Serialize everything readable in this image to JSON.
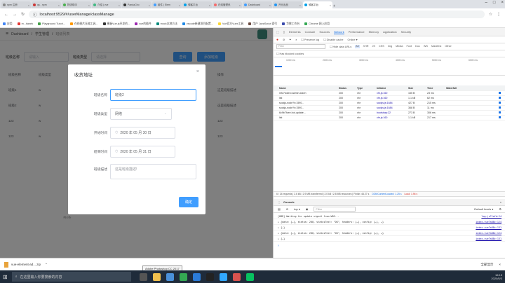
{
  "tabs": [
    {
      "label": "npm 注册",
      "color": "#888"
    },
    {
      "label": "qs - npm",
      "color": "#cb3837"
    },
    {
      "label": "物流助手",
      "color": "#4caf50"
    },
    {
      "label": "介绍 | vue",
      "color": "#42b983"
    },
    {
      "label": "PandaCho",
      "color": "#333"
    },
    {
      "label": "组件 | Elem",
      "color": "#409eff"
    },
    {
      "label": "骑客平台",
      "color": "#00a0e9"
    },
    {
      "label": "在线管理系",
      "color": "#f56c6c"
    },
    {
      "label": "Dashboard",
      "color": "#409eff"
    },
    {
      "label": "开元出品",
      "color": "#2196f3"
    },
    {
      "label": "骑客平台",
      "color": "#00a0e9",
      "active": true
    }
  ],
  "url": "localhost:9529/#/userManage/classManage",
  "bookmarks": [
    "应用",
    "m...tianek",
    "Playground Tutori...",
    "在线图片压缩工具...",
    "模板Vue.js开发的...",
    "vue的插件",
    "mock本地方法",
    "vscode新建项目配置...",
    "Vue官方Vuex工具",
    "用户 JavaScript 索引",
    "华数工作台",
    "Chrome 网上应用"
  ],
  "page": {
    "breadcrumb": [
      "Dashboard",
      "学生管理",
      "班级列表"
    ],
    "search_label_1": "班级名称",
    "search_label_2": "班级类型",
    "search_placeholder": "请输入",
    "select_placeholder": "请选择",
    "search_btn": "查询",
    "add_btn": "添加班级",
    "table_headers": [
      "班级名称",
      "班级类型",
      "开始时间",
      "结束时间",
      "描述",
      "操作"
    ],
    "rows": [
      [
        "班级1",
        "w",
        "",
        "",
        "",
        "这是班级描述"
      ],
      [
        "班级2",
        "w",
        "",
        "",
        "",
        "这是班级描述"
      ],
      [
        "123",
        "w",
        "",
        "",
        "",
        "123"
      ],
      [
        "123",
        "w",
        "",
        "",
        "",
        "123"
      ]
    ],
    "footer_text": "共0条"
  },
  "dialog": {
    "title": "收货地址",
    "fields": [
      {
        "label": "班级名称",
        "value": "班级2"
      },
      {
        "label": "班级类型",
        "value": "网络"
      },
      {
        "label": "开始时间",
        "value": "2020 年 05 月 30 日"
      },
      {
        "label": "结束时间",
        "value": "2020 年 05 月 31 日"
      },
      {
        "label": "班级描述",
        "value": "这是班级描述!"
      }
    ],
    "submit": "确定",
    "close": "×"
  },
  "devtools": {
    "tabs": [
      "Elements",
      "Console",
      "Sources",
      "Network",
      "Performance",
      "Memory",
      "Application",
      "Security"
    ],
    "active_tab": "Network",
    "toolbar": [
      "Preserve log",
      "Disable cache",
      "Online"
    ],
    "filter_placeholder": "Filter",
    "filter_types": [
      "Hide data URLs",
      "All",
      "XHR",
      "JS",
      "CSS",
      "Img",
      "Media",
      "Font",
      "Doc",
      "WS",
      "Manifest",
      "Other"
    ],
    "blocked": "Has blocked cookies",
    "timeline_ticks": [
      "1000 ms",
      "2000 ms",
      "3000 ms",
      "4000 ms",
      "5000 ms",
      "6000 ms"
    ],
    "headers": [
      "Name",
      "Status",
      "Type",
      "Initiator",
      "Size",
      "Time",
      "Waterfall"
    ],
    "requests": [
      [
        "info?token=admin-token",
        "200",
        "xhr",
        "xhr.js:160",
        "155 B",
        "23 ms"
      ],
      [
        "list",
        "200",
        "xhr",
        "xhr.js:160",
        "1.1 kB",
        "62 ms"
      ],
      [
        "sockjs-node?t=1590...",
        "200",
        "xhr",
        "sockjs.js:1684",
        "427 B",
        "215 ms"
      ],
      [
        "sockjs-node?t=1590...",
        "200",
        "xhr",
        "sockjs.js:1684",
        "368 B",
        "11 ms"
      ],
      [
        "6c9b7fcee.hot-update...",
        "200",
        "xhr",
        "bootstrap:22",
        "273 B",
        "306 ms"
      ],
      [
        "list",
        "200",
        "xhr",
        "xhr.js:160",
        "1.1 kB",
        "217 ms"
      ]
    ],
    "status_bar": "6 / 14 requests  |  2.6 kB / 2.9 MB transferred  |  2.0 kB / 2.8 MB resources  |  Finish: 46.27 s",
    "dcl": "DOMContentLoaded: 1.25 s",
    "load": "Load: 1.96 s",
    "console_tab": "Console",
    "console_context": "top",
    "console_filter": "Filter",
    "console_levels": "Default levels",
    "console_lines": [
      [
        "[HMR] Waiting for update signal from WDS...",
        "log.js?1afd:24"
      ],
      [
        "▸ {data: {…}, status: 200, statusText: \"OK\", headers: {…}, config: {…}, …}",
        "index.vue?a88c:124"
      ],
      [
        "▸ {…}",
        "index.vue?a88c:131"
      ],
      [
        "▸ {data: {…}, status: 200, statusText: \"OK\", headers: {…}, config: {…}, …}",
        "index.vue?a88c:124"
      ],
      [
        "▸ {…}",
        "index.vue?a88c:131"
      ]
    ]
  },
  "download": {
    "file": "vue-element-ad....zip",
    "show_all": "全部显示"
  },
  "taskbar": {
    "search": "在这里输入你要搜索的内容",
    "tooltip": "Adobe Photoshop CC 2017",
    "time": "16:15",
    "date": "2020/5/3"
  }
}
